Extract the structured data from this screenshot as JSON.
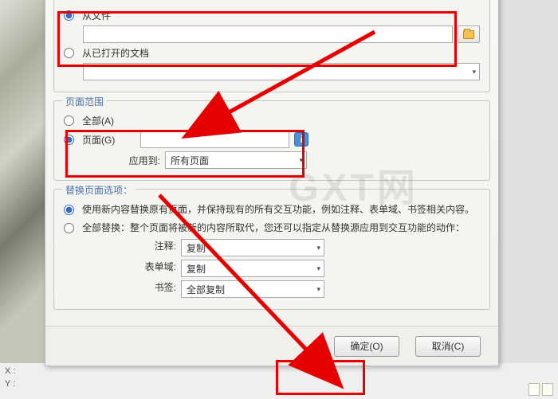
{
  "source": {
    "from_file_label": "从文件",
    "from_open_doc_label": "从已打开的文档",
    "file_path_value": "",
    "open_doc_selected": ""
  },
  "range": {
    "title": "页面范围",
    "all_label": "全部(A)",
    "pages_label": "页面(G)",
    "pages_value": "",
    "apply_to_label": "应用到:",
    "apply_to_selected": "所有页面"
  },
  "options": {
    "title": "替换页面选项：",
    "opt1": "使用新内容替换原有页面，并保持现有的所有交互功能，例如注释、表单域、书签相关内容。",
    "opt2": "全部替换：整个页面将被新的内容所取代，您还可以指定从替换源应用到交互功能的动作：",
    "annotation_label": "注释:",
    "annotation_selected": "复制",
    "form_label": "表单域:",
    "form_selected": "复制",
    "bookmark_label": "书签:",
    "bookmark_selected": "全部复制"
  },
  "footer": {
    "ok_label": "确定(O)",
    "cancel_label": "取消(C)"
  },
  "watermark": "GXT网",
  "side": {
    "x": "X :",
    "y": "Y :"
  },
  "info_glyph": "i"
}
